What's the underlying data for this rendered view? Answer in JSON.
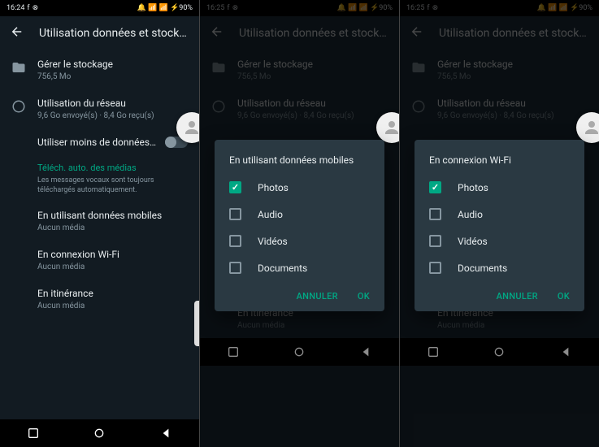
{
  "screen1": {
    "time": "16:24",
    "statusIcons": "🔔 📶 📶 ⚡90%",
    "title": "Utilisation données et stock…",
    "storage": {
      "title": "Gérer le stockage",
      "sub": "756,5 Mo"
    },
    "network": {
      "title": "Utilisation du réseau",
      "sub": "9,6 Go envoyé(s) · 8,4 Go reçu(s)"
    },
    "lessData": "Utiliser moins de données…",
    "autoSection": {
      "title": "Téléch. auto. des médias",
      "desc": "Les messages vocaux sont toujours téléchargés automatiquement."
    },
    "mobile": {
      "title": "En utilisant données mobiles",
      "sub": "Aucun média"
    },
    "wifi": {
      "title": "En connexion Wi-Fi",
      "sub": "Aucun média"
    },
    "roaming": {
      "title": "En itinérance",
      "sub": "Aucun média"
    }
  },
  "screen2": {
    "time": "16:25",
    "title": "Utilisation données et stock…",
    "dialogTitle": "En utilisant données mobiles",
    "options": [
      {
        "label": "Photos",
        "checked": true
      },
      {
        "label": "Audio",
        "checked": false
      },
      {
        "label": "Vidéos",
        "checked": false
      },
      {
        "label": "Documents",
        "checked": false
      }
    ],
    "cancel": "ANNULER",
    "ok": "OK",
    "roaming": {
      "title": "En itinérance",
      "sub": "Aucun média"
    }
  },
  "screen3": {
    "time": "16:25",
    "title": "Utilisation données et stock…",
    "dialogTitle": "En connexion Wi-Fi",
    "options": [
      {
        "label": "Photos",
        "checked": true
      },
      {
        "label": "Audio",
        "checked": false
      },
      {
        "label": "Vidéos",
        "checked": false
      },
      {
        "label": "Documents",
        "checked": false
      }
    ],
    "cancel": "ANNULER",
    "ok": "OK",
    "roaming": {
      "title": "En itinérance",
      "sub": "Aucun média"
    }
  }
}
